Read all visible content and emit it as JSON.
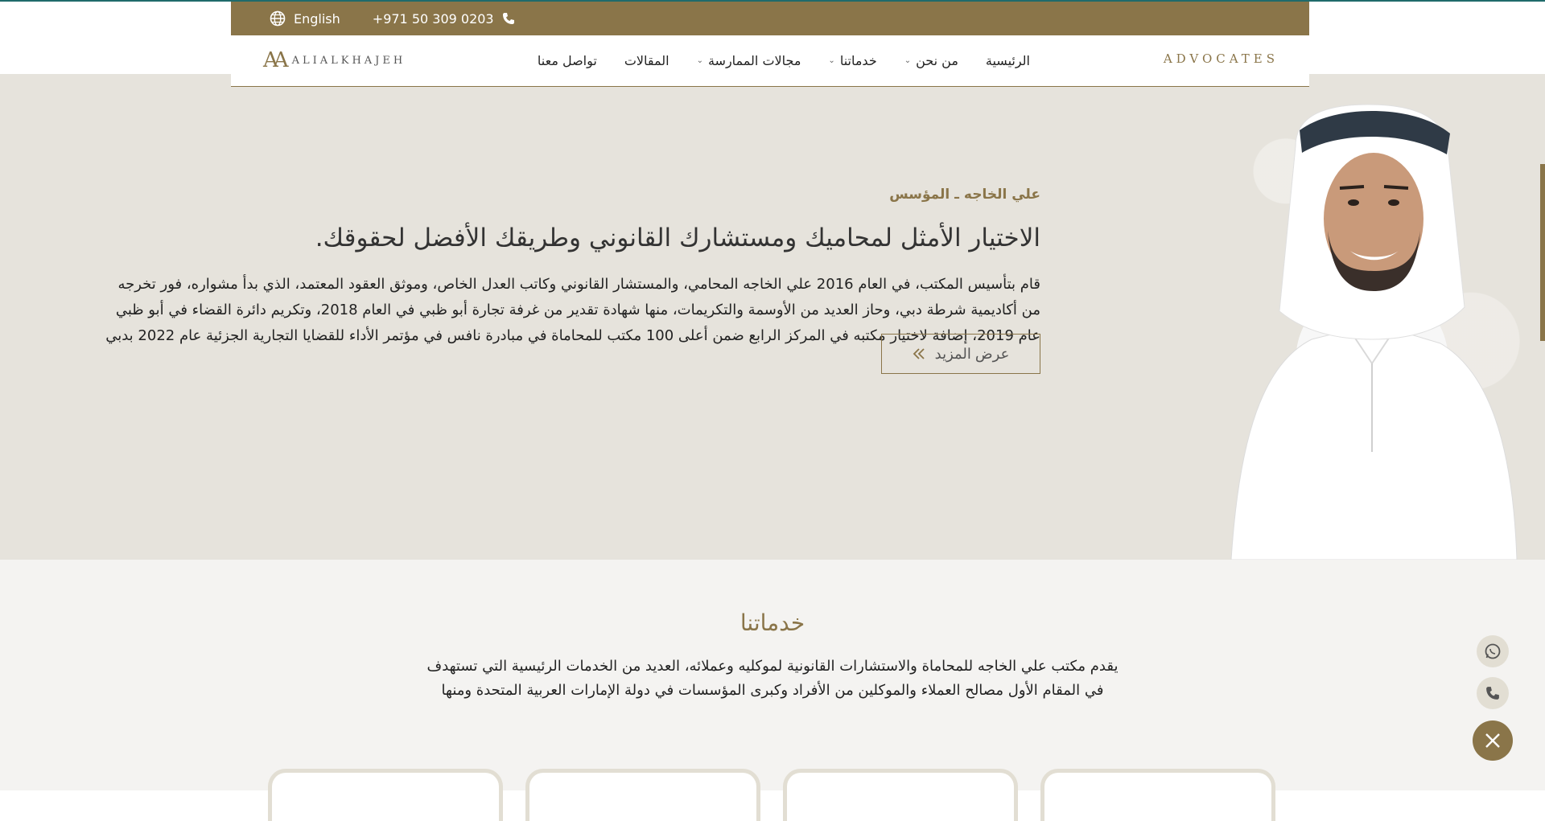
{
  "topbar": {
    "language": "English",
    "phone": "+971 50 309 0203"
  },
  "logo": {
    "mark": "AA",
    "text": "ALIALKHAJEH"
  },
  "nav": {
    "items": [
      {
        "label": "الرئيسية",
        "dropdown": false
      },
      {
        "label": "من نحن",
        "dropdown": true
      },
      {
        "label": "خدماتنا",
        "dropdown": true
      },
      {
        "label": "مجالات الممارسة",
        "dropdown": true
      },
      {
        "label": "المقالات",
        "dropdown": false
      },
      {
        "label": "تواصل معنا",
        "dropdown": false
      }
    ],
    "tagline": "ADVOCATES"
  },
  "hero": {
    "eyebrow": "علي الخاجه ـ المؤسس",
    "title": "الاختيار الأمثل لمحاميك ومستشارك القانوني وطريقك الأفضل لحقوقك.",
    "paragraph": "قام بتأسيس المكتب، في العام 2016 علي الخاجه المحامي، والمستشار القانوني وكاتب العدل الخاص، وموثق العقود المعتمد، الذي بدأ مشواره، فور تخرجه من أكاديمية شرطة دبي، وحاز العديد من الأوسمة والتكريمات، منها شهادة تقدير من غرفة تجارة أبو ظبي في العام 2018، وتكريم دائرة القضاء في أبو ظبي عام 2019، إضافة لاختيار مكتبه في المركز الرابع ضمن أعلى 100 مكتب للمحاماة في مبادرة نافس في مؤتمر الأداء للقضايا التجارية الجزئية عام 2022 بدبي",
    "more_button": "عرض المزيد"
  },
  "services": {
    "title": "خدماتنا",
    "description": "يقدم مكتب علي الخاجه للمحاماة والاستشارات القانونية لموكليه وعملائه، العديد من الخدمات الرئيسية التي تستهدف في المقام الأول مصالح العملاء والموكلين من الأفراد وكبرى المؤسسات في دولة الإمارات العربية المتحدة ومنها"
  },
  "colors": {
    "brand": "#8a7549",
    "hero_bg": "#e6e3dc",
    "accent_line": "#1f6b6b"
  },
  "icons": {
    "language": "globe-icon",
    "phone": "phone-icon",
    "more": "double-chevron-icon",
    "whatsapp": "whatsapp-icon",
    "call": "phone-icon",
    "close": "close-icon"
  }
}
